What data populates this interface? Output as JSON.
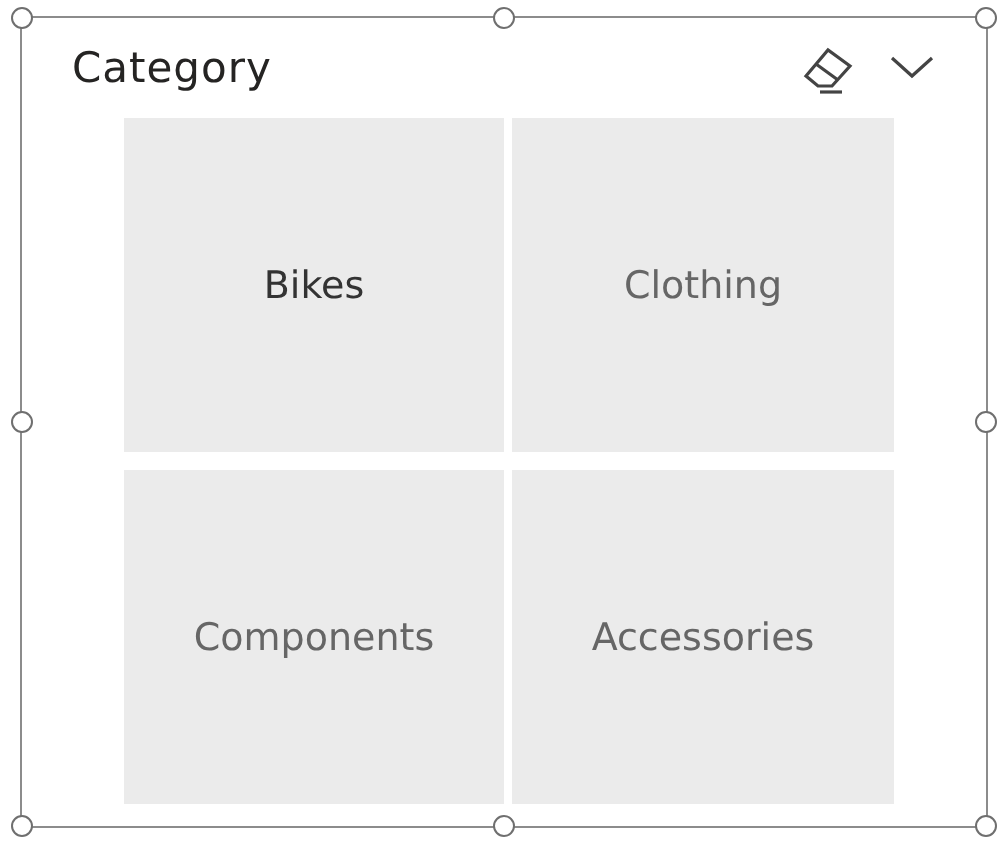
{
  "slicer": {
    "title": "Category",
    "tiles": [
      {
        "label": "Bikes",
        "selected": true
      },
      {
        "label": "Clothing",
        "selected": false
      },
      {
        "label": "Components",
        "selected": false
      },
      {
        "label": "Accessories",
        "selected": false
      }
    ]
  }
}
